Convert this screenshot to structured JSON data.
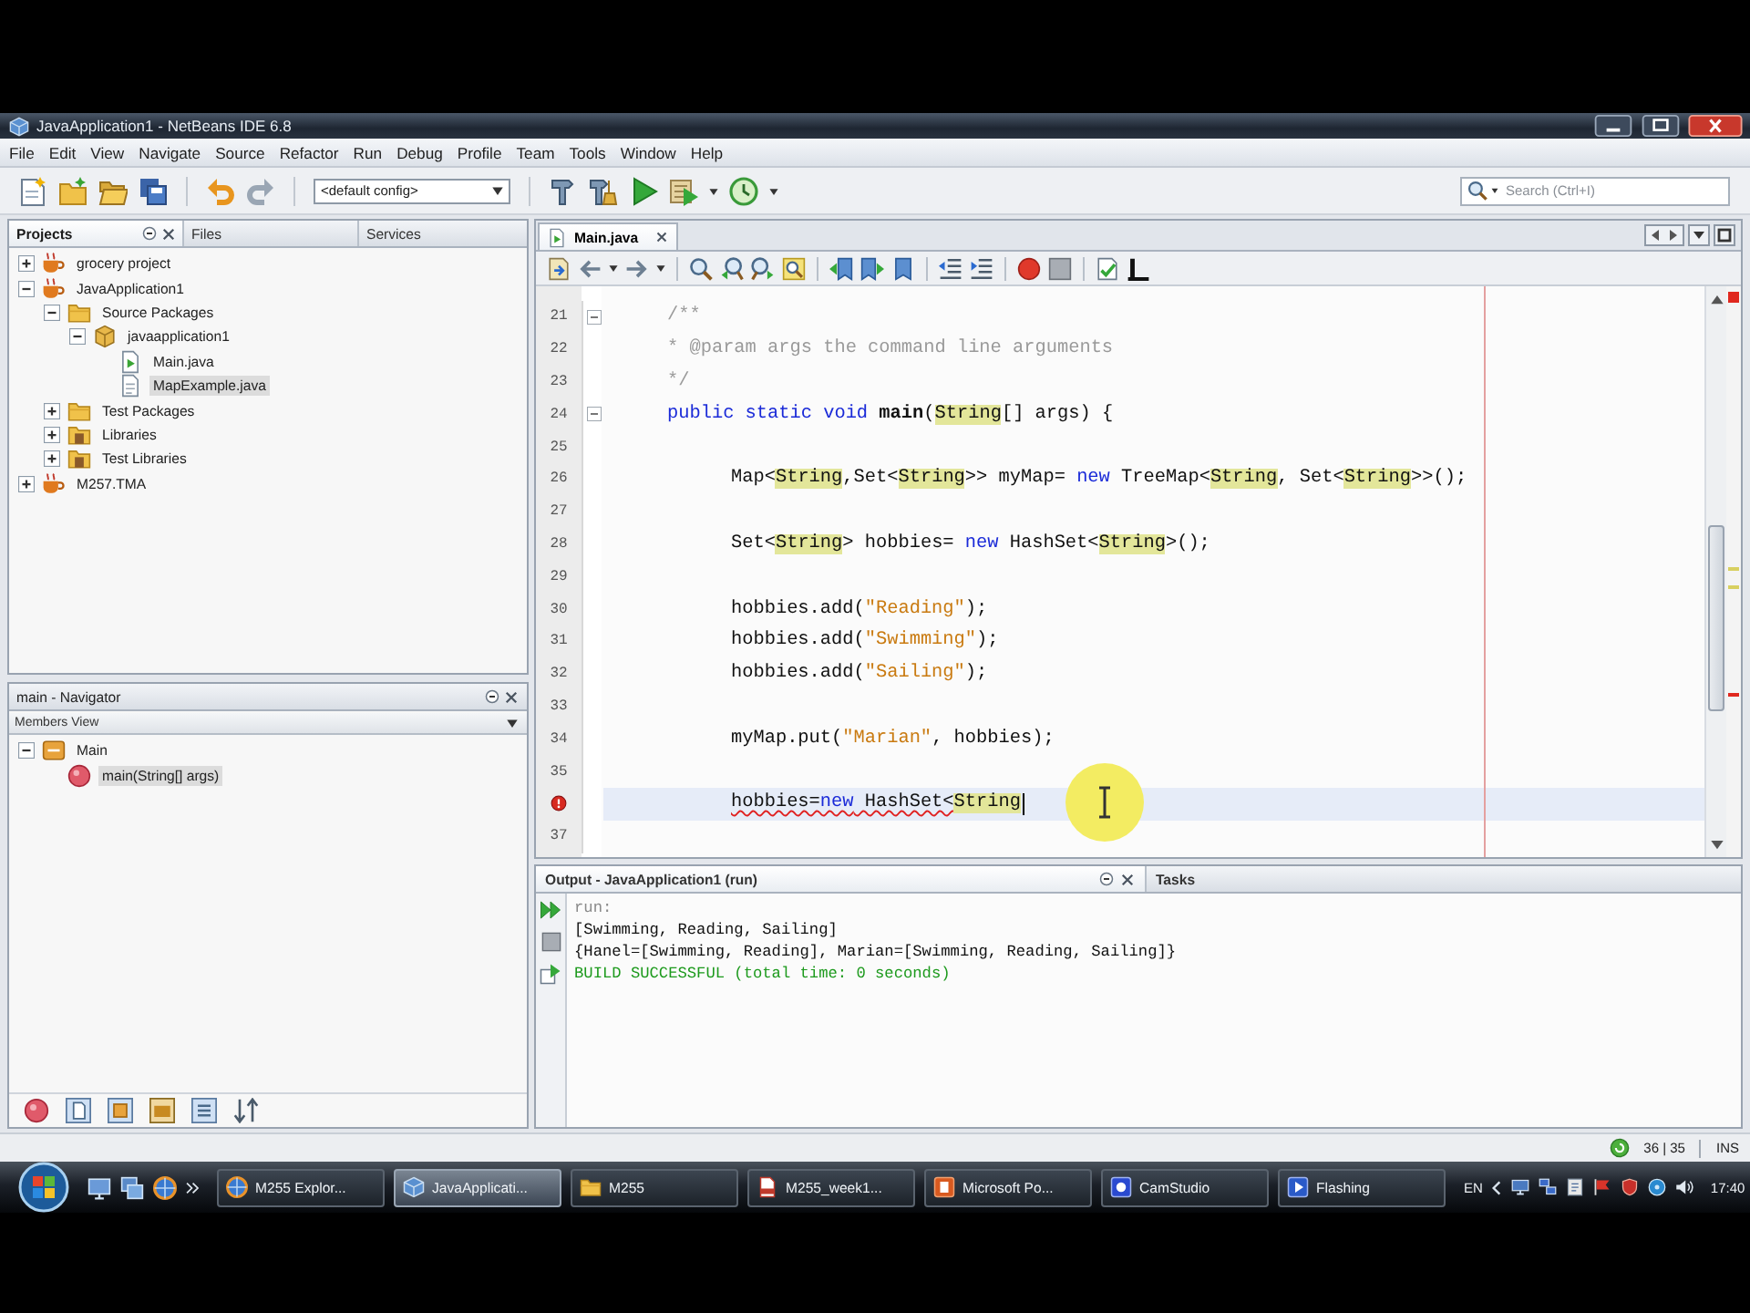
{
  "window": {
    "title": "JavaApplication1 - NetBeans IDE 6.8"
  },
  "menu": [
    "File",
    "Edit",
    "View",
    "Navigate",
    "Source",
    "Refactor",
    "Run",
    "Debug",
    "Profile",
    "Team",
    "Tools",
    "Window",
    "Help"
  ],
  "toolbar": {
    "config": "<default config>",
    "search": {
      "placeholder": "Search (Ctrl+I)"
    }
  },
  "projects": {
    "tabs": [
      {
        "label": "Projects",
        "selected": true
      },
      {
        "label": "Files",
        "selected": false
      },
      {
        "label": "Services",
        "selected": false
      }
    ],
    "tree": [
      {
        "label": "grocery project",
        "kind": "project",
        "expanded": false,
        "selected": false
      },
      {
        "label": "JavaApplication1",
        "kind": "project",
        "expanded": true,
        "selected": false,
        "children": [
          {
            "label": "Source Packages",
            "kind": "folder",
            "expanded": true,
            "selected": false,
            "children": [
              {
                "label": "javaapplication1",
                "kind": "package",
                "expanded": true,
                "selected": false,
                "children": [
                  {
                    "label": "Main.java",
                    "kind": "mainfile",
                    "selected": false
                  },
                  {
                    "label": "MapExample.java",
                    "kind": "file",
                    "selected": true
                  }
                ]
              }
            ]
          },
          {
            "label": "Test Packages",
            "kind": "folder",
            "expanded": false,
            "selected": false
          },
          {
            "label": "Libraries",
            "kind": "library",
            "expanded": false,
            "selected": false
          },
          {
            "label": "Test Libraries",
            "kind": "library",
            "expanded": false,
            "selected": false
          }
        ]
      },
      {
        "label": "M257.TMA",
        "kind": "project",
        "expanded": false,
        "selected": false
      }
    ]
  },
  "navigator": {
    "title": "main - Navigator",
    "view": "Members View",
    "tree": [
      {
        "label": "Main",
        "kind": "class",
        "expanded": true,
        "selected": false,
        "children": [
          {
            "label": "main(String[] args)",
            "kind": "method",
            "selected": true
          }
        ]
      }
    ]
  },
  "editor": {
    "tabs": [
      {
        "label": "Main.java",
        "selected": true
      }
    ],
    "lines": [
      {
        "number": "21",
        "fold": true,
        "current": false,
        "error": false,
        "tokens": [
          {
            "text": "/**",
            "kind": "comment"
          }
        ]
      },
      {
        "number": "22",
        "fold": false,
        "current": false,
        "error": false,
        "tokens": [
          {
            "text": "* @param args the command line arguments",
            "kind": "comment"
          }
        ]
      },
      {
        "number": "23",
        "fold": false,
        "current": false,
        "error": false,
        "tokens": [
          {
            "text": "*/",
            "kind": "comment"
          }
        ]
      },
      {
        "number": "24",
        "fold": true,
        "current": false,
        "error": false,
        "tokens": [
          {
            "text": "public static void ",
            "kind": "keyword"
          },
          {
            "text": "main",
            "kind": "method"
          },
          {
            "text": "(",
            "kind": "plain"
          },
          {
            "text": "String",
            "kind": "mark"
          },
          {
            "text": "[] args) {",
            "kind": "plain"
          }
        ],
        "children": [
          {
            "number": "25",
            "fold": false,
            "current": false,
            "error": false
          },
          {
            "number": "26",
            "fold": false,
            "current": false,
            "error": false,
            "tokens": [
              {
                "text": "Map<",
                "kind": "plain"
              },
              {
                "text": "String",
                "kind": "mark"
              },
              {
                "text": ",Set<",
                "kind": "plain"
              },
              {
                "text": "String",
                "kind": "mark"
              },
              {
                "text": ">> myMap= ",
                "kind": "plain"
              },
              {
                "text": "new",
                "kind": "keyword"
              },
              {
                "text": " TreeMap<",
                "kind": "plain"
              },
              {
                "text": "String",
                "kind": "mark"
              },
              {
                "text": ", Set<",
                "kind": "plain"
              },
              {
                "text": "String",
                "kind": "mark"
              },
              {
                "text": ">>();",
                "kind": "plain"
              }
            ]
          },
          {
            "number": "27",
            "fold": false,
            "current": false,
            "error": false
          },
          {
            "number": "28",
            "fold": false,
            "current": false,
            "error": false,
            "tokens": [
              {
                "text": "Set<",
                "kind": "plain"
              },
              {
                "text": "String",
                "kind": "mark"
              },
              {
                "text": "> hobbies= ",
                "kind": "plain"
              },
              {
                "text": "new",
                "kind": "keyword"
              },
              {
                "text": " HashSet<",
                "kind": "plain"
              },
              {
                "text": "String",
                "kind": "mark"
              },
              {
                "text": ">();",
                "kind": "plain"
              }
            ]
          },
          {
            "number": "29",
            "fold": false,
            "current": false,
            "error": false
          },
          {
            "number": "30",
            "fold": false,
            "current": false,
            "error": false,
            "tokens": [
              {
                "text": "hobbies.add(",
                "kind": "plain"
              },
              {
                "text": "\"Reading\"",
                "kind": "string"
              },
              {
                "text": ");",
                "kind": "plain"
              }
            ]
          },
          {
            "number": "31",
            "fold": false,
            "current": false,
            "error": false,
            "tokens": [
              {
                "text": "hobbies.add(",
                "kind": "plain"
              },
              {
                "text": "\"Swimming\"",
                "kind": "string"
              },
              {
                "text": ");",
                "kind": "plain"
              }
            ]
          },
          {
            "number": "32",
            "fold": false,
            "current": false,
            "error": false,
            "tokens": [
              {
                "text": "hobbies.add(",
                "kind": "plain"
              },
              {
                "text": "\"Sailing\"",
                "kind": "string"
              },
              {
                "text": ");",
                "kind": "plain"
              }
            ]
          },
          {
            "number": "33",
            "fold": false,
            "current": false,
            "error": false
          },
          {
            "number": "34",
            "fold": false,
            "current": false,
            "error": false,
            "tokens": [
              {
                "text": "myMap.put(",
                "kind": "plain"
              },
              {
                "text": "\"Marian\"",
                "kind": "string"
              },
              {
                "text": ", hobbies);",
                "kind": "plain"
              }
            ]
          },
          {
            "number": "35",
            "fold": false,
            "current": false,
            "error": false
          },
          {
            "fold": false,
            "current": true,
            "error": true,
            "tokens": [
              {
                "text": "hobbies=",
                "kind": "plain"
              },
              {
                "text": "new",
                "kind": "keyword"
              },
              {
                "text": " HashSet<",
                "kind": "plain"
              },
              {
                "text": "String",
                "kind": "mark"
              }
            ]
          },
          {
            "number": "37",
            "fold": false,
            "current": false,
            "error": false
          }
        ]
      }
    ]
  },
  "output": {
    "tabs": [
      {
        "label": "Output - JavaApplication1 (run)",
        "selected": true
      },
      {
        "label": "Tasks",
        "selected": false
      }
    ],
    "lines": [
      {
        "text": "run:",
        "kind": "info"
      },
      {
        "text": "[Swimming, Reading, Sailing]",
        "kind": "plain"
      },
      {
        "text": "{Hanel=[Swimming, Reading], Marian=[Swimming, Reading, Sailing]}",
        "kind": "plain"
      },
      {
        "text": "BUILD SUCCESSFUL (total time: 0 seconds)",
        "kind": "success"
      }
    ]
  },
  "status_bar": {
    "position": "36 | 35",
    "mode": "INS"
  },
  "taskbar": {
    "buttons": [
      {
        "label": "M255 Explor...",
        "kind": "browser",
        "selected": false
      },
      {
        "label": "JavaApplicati...",
        "kind": "ide",
        "selected": true
      },
      {
        "label": "M255",
        "kind": "folder",
        "selected": false
      },
      {
        "label": "M255_week1...",
        "kind": "document",
        "selected": false
      },
      {
        "label": "Microsoft Po...",
        "kind": "presentation",
        "selected": false
      },
      {
        "label": "CamStudio",
        "kind": "recorder",
        "selected": false
      },
      {
        "label": "Flashing",
        "kind": "player",
        "selected": false
      }
    ],
    "language": "EN",
    "clock": "17:40"
  }
}
